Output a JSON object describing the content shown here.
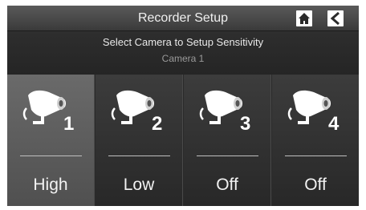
{
  "header": {
    "title": "Recorder Setup",
    "home_icon": "home-icon",
    "back_icon": "back-arrow-icon"
  },
  "info": {
    "instruction": "Select Camera to Setup Sensitivity",
    "selected_camera": "Camera 1"
  },
  "cameras": [
    {
      "number": "1",
      "sensitivity": "High",
      "selected": true,
      "icon": "security-camera-icon"
    },
    {
      "number": "2",
      "sensitivity": "Low",
      "selected": false,
      "icon": "security-camera-icon"
    },
    {
      "number": "3",
      "sensitivity": "Off",
      "selected": false,
      "icon": "security-camera-icon"
    },
    {
      "number": "4",
      "sensitivity": "Off",
      "selected": false,
      "icon": "security-camera-icon"
    }
  ],
  "colors": {
    "background": "#2a2a2a",
    "selected_tile": "#5c5c5c",
    "text": "#ffffff"
  }
}
